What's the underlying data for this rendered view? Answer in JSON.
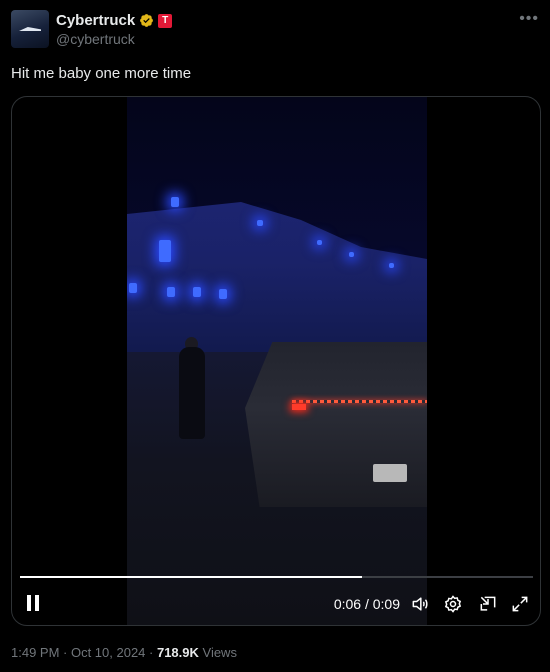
{
  "author": {
    "name": "Cybertruck",
    "handle": "@cybertruck",
    "verified_icon": "gold-checkmark-icon",
    "brand_badge_letter": "T"
  },
  "tweet": {
    "text": "Hit me baby one more time"
  },
  "video": {
    "time_display": "0:06 / 0:09",
    "progress_fraction": 0.6667
  },
  "meta": {
    "timestamp": "1:49 PM · Oct 10, 2024 · ",
    "views_count": "718.9K",
    "views_label": " Views"
  },
  "icons": [
    "more-icon",
    "pause-icon",
    "volume-icon",
    "settings-icon",
    "picture-in-picture-icon",
    "fullscreen-icon"
  ],
  "colors": {
    "background": "#000000",
    "text_primary": "#e7e9ea",
    "text_secondary": "#71767b",
    "badge_red": "#e31937",
    "verified_gold": "#e2b719"
  }
}
